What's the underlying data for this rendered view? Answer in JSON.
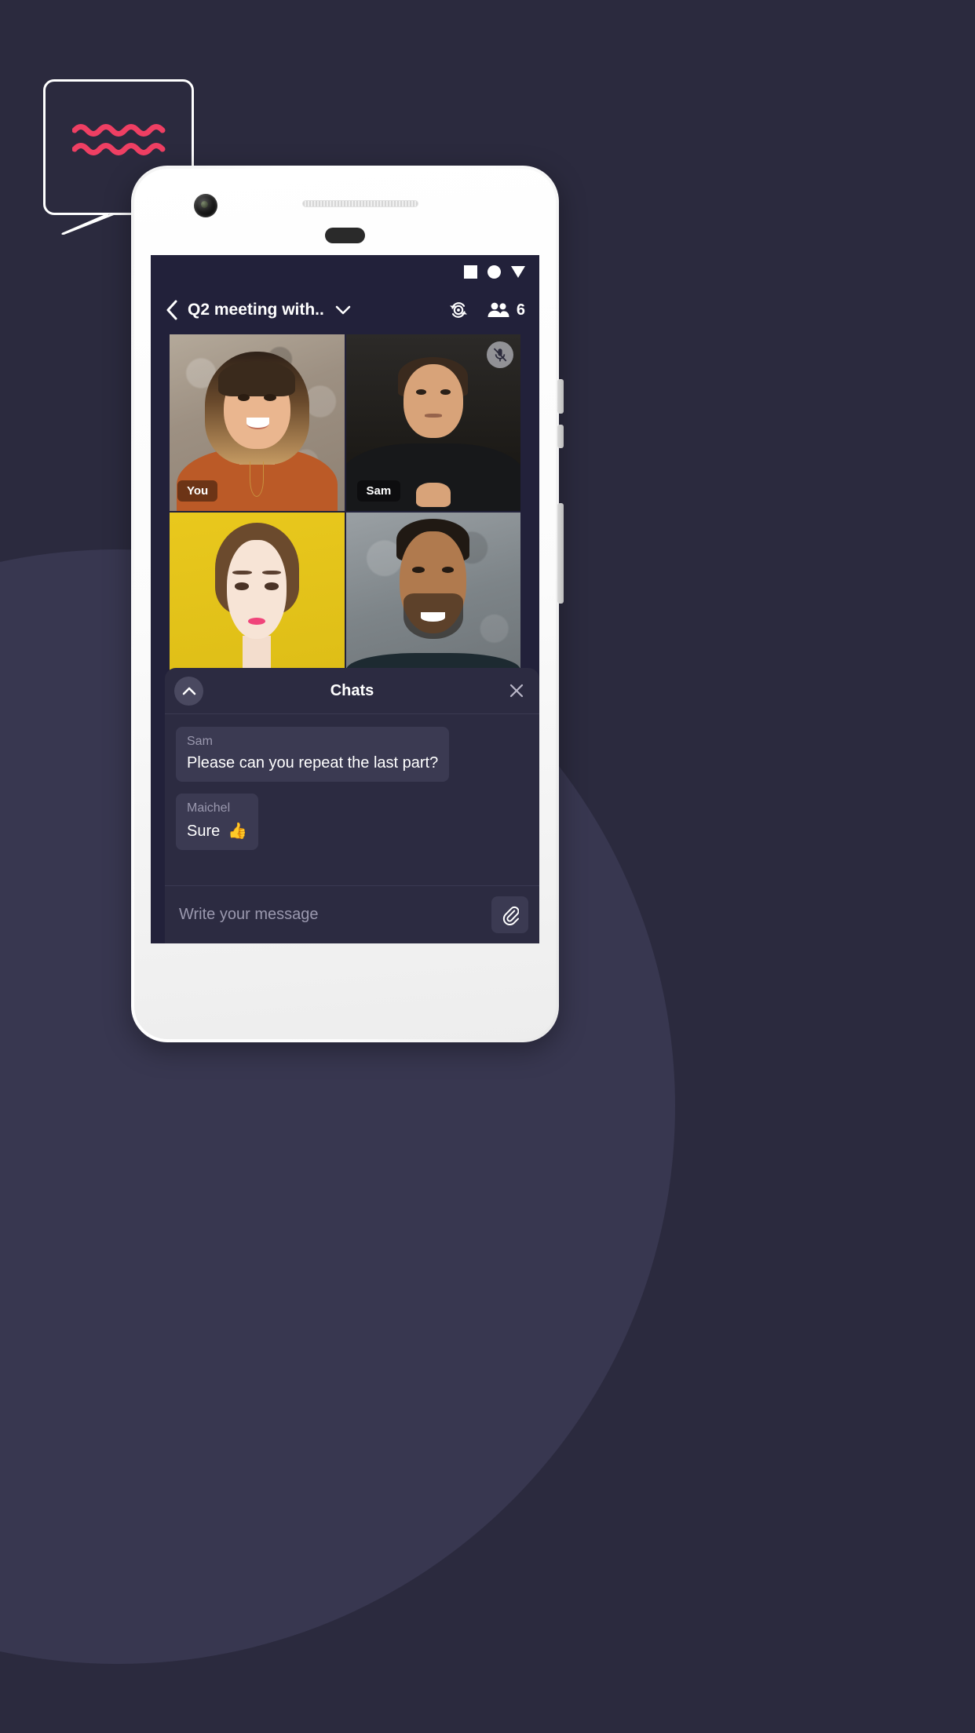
{
  "background": {
    "page_color": "#2b2a3e",
    "blob_color": "#383750"
  },
  "decoration": {
    "speech_bubble": {
      "name": "speech-bubble-outline",
      "stroke_color": "#ffffff",
      "wave_color": "#ef3f63",
      "wave_count": 2
    }
  },
  "device": {
    "name": "white-android-phone",
    "body_color": "#ffffff",
    "screen_bg": "#22213a"
  },
  "status_bar": {
    "icons": [
      "square-icon",
      "circle-icon",
      "triangle-down-icon"
    ]
  },
  "app_bar": {
    "back_icon": "chevron-left-icon",
    "title": "Q2 meeting with..",
    "title_caret_icon": "chevron-down-icon",
    "flip_camera_icon": "camera-flip-icon",
    "participants_icon": "people-icon",
    "participants_count": "6"
  },
  "video_grid": {
    "tiles": [
      {
        "name": "You",
        "muted": false,
        "label_visible": true
      },
      {
        "name": "Sam",
        "muted": true,
        "label_visible": true,
        "mute_icon": "microphone-off-icon"
      },
      {
        "name": "",
        "muted": false,
        "label_visible": false
      },
      {
        "name": "",
        "muted": false,
        "label_visible": false
      }
    ]
  },
  "chats_panel": {
    "collapse_icon": "chevron-up-icon",
    "title": "Chats",
    "close_icon": "close-icon",
    "messages": [
      {
        "author": "Sam",
        "text": "Please can you repeat the last part?",
        "emoji": ""
      },
      {
        "author": "Maichel",
        "text": "Sure",
        "emoji": "👍"
      }
    ],
    "composer": {
      "placeholder": "Write your message",
      "value": "",
      "attach_icon": "paperclip-icon"
    }
  }
}
